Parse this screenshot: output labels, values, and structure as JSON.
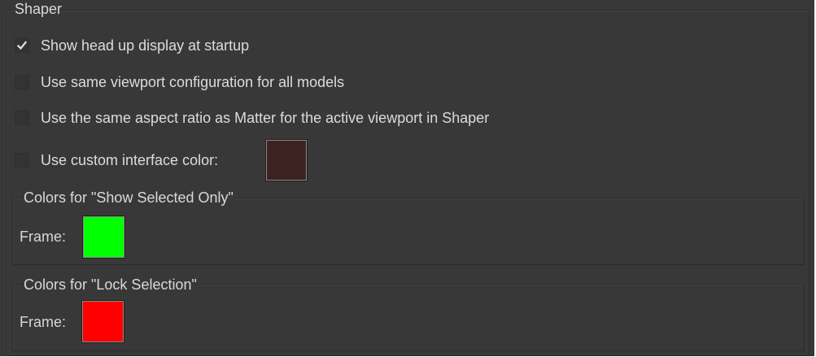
{
  "shaper": {
    "title": "Shaper",
    "options": [
      {
        "label": "Show head up display at startup",
        "checked": true
      },
      {
        "label": "Use same viewport configuration for all models",
        "checked": false
      },
      {
        "label": "Use the same aspect ratio as Matter for the active viewport in Shaper",
        "checked": false
      },
      {
        "label": "Use custom interface color:",
        "checked": false
      }
    ],
    "custom_interface_color": "#3d2222"
  },
  "show_selected_only": {
    "title": "Colors for \"Show Selected Only\"",
    "frame_label": "Frame:",
    "frame_color": "#00ff00"
  },
  "lock_selection": {
    "title": "Colors for \"Lock Selection\"",
    "frame_label": "Frame:",
    "frame_color": "#ff0000"
  }
}
